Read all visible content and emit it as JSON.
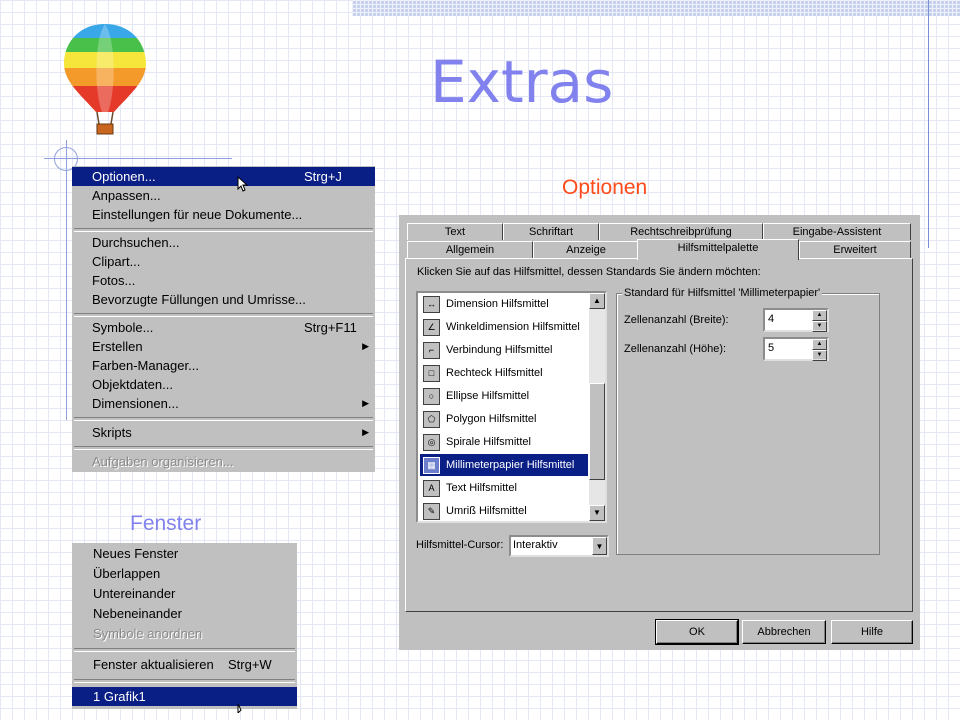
{
  "slide": {
    "title": "Extras",
    "label_optionen": "Optionen",
    "label_fenster": "Fenster",
    "title_color": "#8282ee",
    "accent_color": "#ff4a1a"
  },
  "extras_menu": {
    "items": [
      {
        "label": "Optionen...",
        "shortcut": "Strg+J",
        "selected": true
      },
      {
        "label": "Anpassen...",
        "shortcut": ""
      },
      {
        "label": "Einstellungen für neue Dokumente...",
        "shortcut": ""
      },
      {
        "label": "Durchsuchen...",
        "shortcut": ""
      },
      {
        "label": "Clipart...",
        "shortcut": ""
      },
      {
        "label": "Fotos...",
        "shortcut": ""
      },
      {
        "label": "Bevorzugte Füllungen und Umrisse...",
        "shortcut": ""
      },
      {
        "label": "Symbole...",
        "shortcut": "Strg+F11"
      },
      {
        "label": "Erstellen",
        "shortcut": "",
        "submenu": true
      },
      {
        "label": "Farben-Manager...",
        "shortcut": ""
      },
      {
        "label": "Objektdaten...",
        "shortcut": ""
      },
      {
        "label": "Dimensionen...",
        "shortcut": "",
        "submenu": true
      },
      {
        "label": "Skripts",
        "shortcut": "",
        "submenu": true
      },
      {
        "label": "Aufgaben organisieren...",
        "shortcut": "",
        "disabled": true
      }
    ]
  },
  "fenster_menu": {
    "items": [
      {
        "label": "Neues Fenster",
        "shortcut": ""
      },
      {
        "label": "Überlappen",
        "shortcut": ""
      },
      {
        "label": "Untereinander",
        "shortcut": ""
      },
      {
        "label": "Nebeneinander",
        "shortcut": ""
      },
      {
        "label": "Symbole anordnen",
        "shortcut": "",
        "disabled": true
      },
      {
        "label": "Fenster aktualisieren",
        "shortcut": "Strg+W"
      },
      {
        "label": "1 Grafik1",
        "shortcut": "",
        "selected": true
      }
    ]
  },
  "dialog": {
    "tabs_row1": [
      "Text",
      "Schriftart",
      "Rechtschreibprüfung",
      "Eingabe-Assistent"
    ],
    "tabs_row2": [
      "Allgemein",
      "Anzeige",
      "Hilfsmittelpalette",
      "Erweitert"
    ],
    "active_tab": "Hilfsmittelpalette",
    "instruction": "Klicken Sie auf das Hilfsmittel, dessen Standards Sie ändern möchten:",
    "tools": [
      {
        "label": "Dimension Hilfsmittel",
        "icon": "dimension-icon",
        "glyph": "↔"
      },
      {
        "label": "Winkeldimension Hilfsmittel",
        "icon": "angle-dimension-icon",
        "glyph": "∠"
      },
      {
        "label": "Verbindung Hilfsmittel",
        "icon": "connector-icon",
        "glyph": "⌐"
      },
      {
        "label": "Rechteck Hilfsmittel",
        "icon": "rectangle-icon",
        "glyph": "□"
      },
      {
        "label": "Ellipse Hilfsmittel",
        "icon": "ellipse-icon",
        "glyph": "○"
      },
      {
        "label": "Polygon Hilfsmittel",
        "icon": "polygon-icon",
        "glyph": "⬠"
      },
      {
        "label": "Spirale Hilfsmittel",
        "icon": "spiral-icon",
        "glyph": "◎"
      },
      {
        "label": "Millimeterpapier Hilfsmittel",
        "icon": "graph-paper-icon",
        "glyph": "▦",
        "selected": true
      },
      {
        "label": "Text Hilfsmittel",
        "icon": "text-icon",
        "glyph": "A"
      },
      {
        "label": "Umriß Hilfsmittel",
        "icon": "outline-pen-icon",
        "glyph": "✎"
      }
    ],
    "group_title": "Standard für Hilfsmittel 'Millimeterpapier'",
    "field_width_label": "Zellenanzahl (Breite):",
    "field_width_value": "4",
    "field_height_label": "Zellenanzahl (Höhe):",
    "field_height_value": "5",
    "cursor_label": "Hilfsmittel-Cursor:",
    "cursor_value": "Interaktiv",
    "ok_label": "OK",
    "cancel_label": "Abbrechen",
    "help_label": "Hilfe"
  }
}
